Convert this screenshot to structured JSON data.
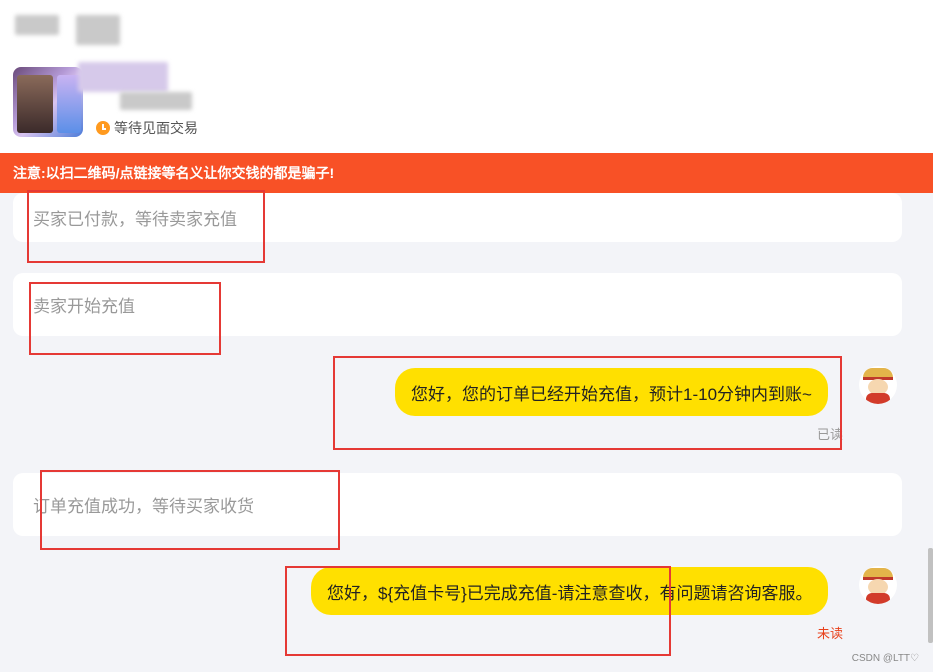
{
  "header": {
    "status_text": "等待见面交易",
    "status_icon": "clock-icon"
  },
  "warning": {
    "text": "注意:以扫二维码/点链接等名义让你交钱的都是骗子!"
  },
  "messages": {
    "sys1": "买家已付款，等待卖家充值",
    "sys2": "卖家开始充值",
    "bubble1": "您好，您的订单已经开始充值，预计1-10分钟内到账~",
    "bubble1_status": "已读",
    "sys3": "订单充值成功，等待买家收货",
    "bubble2": "您好，${充值卡号}已完成充值-请注意查收，有问题请咨询客服。",
    "bubble2_status": "未读"
  },
  "colors": {
    "warning_bg": "#f85126",
    "bubble_bg": "#ffe000",
    "read": "#999999",
    "unread": "#e8411c",
    "annotation": "#e53935"
  },
  "watermark": "CSDN @LTT♡"
}
